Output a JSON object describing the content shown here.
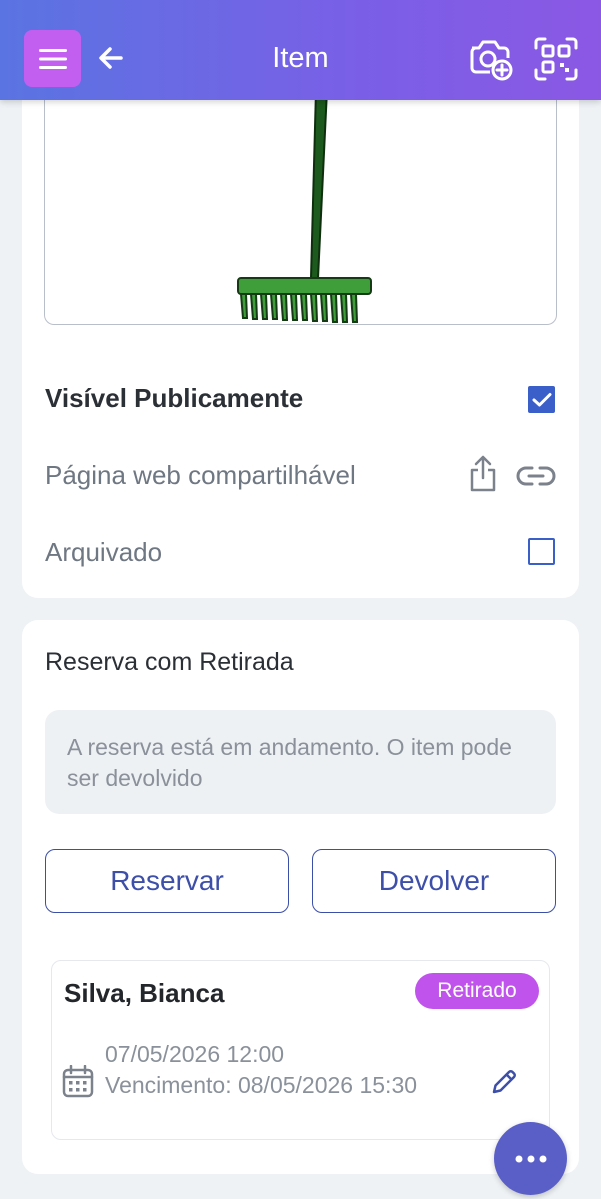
{
  "header": {
    "title": "Item",
    "menu_icon": "menu-icon",
    "back_icon": "arrow-left-icon",
    "camera_icon": "camera-add-icon",
    "qr_icon": "qr-scan-icon",
    "colors": {
      "gradient_start": "#5a74e2",
      "gradient_end": "#8b58e4",
      "menu_bg": "#c25ff0"
    }
  },
  "item": {
    "image": "rake-image",
    "visible_label": "Visível Publicamente",
    "visible_checked": true,
    "webpage_label": "Página web compartilhável",
    "share_icon": "share-icon",
    "link_icon": "link-icon",
    "archived_label": "Arquivado",
    "archived_checked": false
  },
  "reservation": {
    "title": "Reserva com Retirada",
    "info": "A reserva está em andamento. O item pode ser devolvido",
    "reserve_button": "Reservar",
    "return_button": "Devolver",
    "booking": {
      "name": "Silva, Bianca",
      "status": "Retirado",
      "start": "07/05/2026 12:00",
      "due": "Vencimento: 08/05/2026 15:30",
      "calendar_icon": "calendar-icon",
      "edit_icon": "pencil-icon"
    }
  },
  "fab": {
    "icon": "more-horizontal-icon"
  },
  "colors": {
    "accent": "#3b5fc8",
    "badge": "#c053ec",
    "fab": "#5a5fc8"
  }
}
